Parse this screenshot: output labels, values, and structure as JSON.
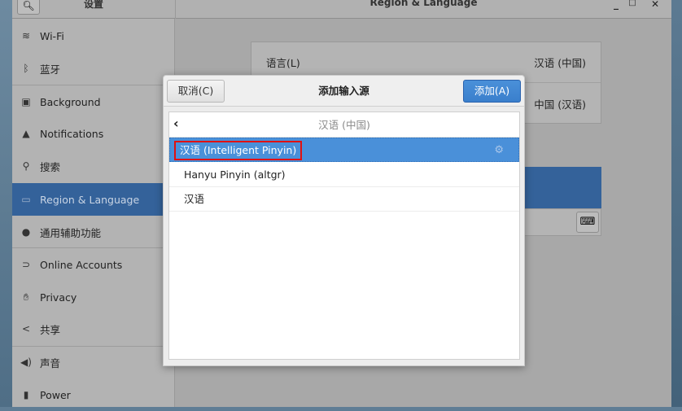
{
  "settings_title": "设置",
  "window_title": "Region & Language",
  "window_controls": {
    "minimize": "_",
    "maximize": "□",
    "close": "✕"
  },
  "sidebar": {
    "items": [
      {
        "label": "Wi-Fi",
        "icon": "wifi-icon"
      },
      {
        "label": "蓝牙",
        "icon": "bluetooth-icon"
      },
      {
        "label": "Background",
        "icon": "background-icon"
      },
      {
        "label": "Notifications",
        "icon": "bell-icon"
      },
      {
        "label": "搜索",
        "icon": "search-icon"
      },
      {
        "label": "Region & Language",
        "icon": "region-icon",
        "selected": true
      },
      {
        "label": "通用辅助功能",
        "icon": "accessibility-icon"
      },
      {
        "label": "Online Accounts",
        "icon": "online-accounts-icon"
      },
      {
        "label": "Privacy",
        "icon": "hand-icon"
      },
      {
        "label": "共享",
        "icon": "share-icon"
      },
      {
        "label": "声音",
        "icon": "speaker-icon"
      },
      {
        "label": "Power",
        "icon": "power-icon"
      }
    ]
  },
  "main": {
    "language_label": "语言(L)",
    "language_value": "汉语 (中国)",
    "formats_value": "中国 (汉语)"
  },
  "dialog": {
    "cancel": "取消(C)",
    "title": "添加输入源",
    "add": "添加(A)",
    "back_label": "汉语 (中国)",
    "rows": [
      "汉语 (Intelligent Pinyin)",
      "Hanyu Pinyin (altgr)",
      "汉语"
    ]
  },
  "colors": {
    "accent": "#4a90d9",
    "selection": "#34629a",
    "highlight_box": "#e01010"
  }
}
